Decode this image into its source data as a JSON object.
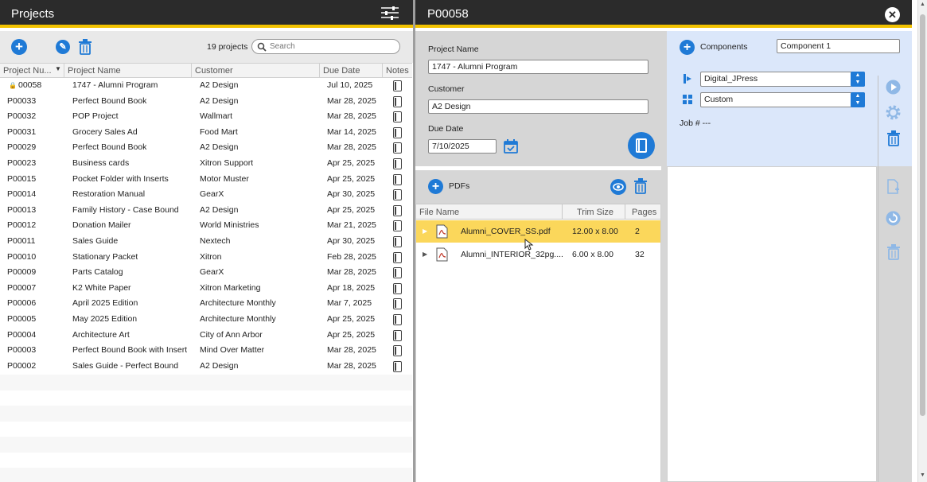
{
  "left_panel": {
    "title": "Projects",
    "project_count": "19 projects",
    "search_placeholder": "Search",
    "columns": [
      "Project Nu...",
      "Project Name",
      "Customer",
      "Due Date",
      "Notes"
    ],
    "rows": [
      [
        "00058",
        "1747 - Alumni Program",
        "A2 Design",
        "Jul 10, 2025"
      ],
      [
        "P00033",
        "Perfect Bound Book",
        "A2 Design",
        "Mar 28, 2025"
      ],
      [
        "P00032",
        "POP Project",
        "Wallmart",
        "Mar 28, 2025"
      ],
      [
        "P00031",
        "Grocery Sales Ad",
        "Food Mart",
        "Mar 14, 2025"
      ],
      [
        "P00029",
        "Perfect Bound Book",
        "A2 Design",
        "Mar 28, 2025"
      ],
      [
        "P00023",
        "Business cards",
        "Xitron Support",
        "Apr 25, 2025"
      ],
      [
        "P00015",
        "Pocket Folder with Inserts",
        "Motor Muster",
        "Apr 25, 2025"
      ],
      [
        "P00014",
        "Restoration Manual",
        "GearX",
        "Apr 30, 2025"
      ],
      [
        "P00013",
        "Family History - Case Bound",
        "A2 Design",
        "Apr 25, 2025"
      ],
      [
        "P00012",
        "Donation Mailer",
        "World Ministries",
        "Mar 21, 2025"
      ],
      [
        "P00011",
        "Sales Guide",
        "Nextech",
        "Apr 30, 2025"
      ],
      [
        "P00010",
        "Stationary Packet",
        "Xitron",
        "Feb 28, 2025"
      ],
      [
        "P00009",
        "Parts Catalog",
        "GearX",
        "Mar 28, 2025"
      ],
      [
        "P00007",
        "K2 White Paper",
        "Xitron Marketing",
        "Apr 18, 2025"
      ],
      [
        "P00006",
        "April 2025 Edition",
        "Architecture Monthly",
        "Mar 7, 2025"
      ],
      [
        "P00005",
        "May 2025 Edition",
        "Architecture Monthly",
        "Apr 25, 2025"
      ],
      [
        "P00004",
        "Architecture Art",
        "City of Ann Arbor",
        "Apr 25, 2025"
      ],
      [
        "P00003",
        "Perfect Bound Book with Insert",
        "Mind Over Matter",
        "Mar 28, 2025"
      ],
      [
        "P00002",
        "Sales Guide - Perfect Bound",
        "A2 Design",
        "Mar 28, 2025"
      ]
    ]
  },
  "detail": {
    "title": "P00058",
    "project_name_label": "Project Name",
    "project_name": "1747 - Alumni Program",
    "customer_label": "Customer",
    "customer": "A2 Design",
    "due_date_label": "Due Date",
    "due_date": "7/10/2025",
    "pdfs_label": "PDFs",
    "pdf_columns": [
      "File Name",
      "Trim Size",
      "Pages"
    ],
    "pdfs": [
      {
        "name": "Alumni_COVER_SS.pdf",
        "trim": "12.00 x 8.00",
        "pages": "2"
      },
      {
        "name": "Alumni_INTERIOR_32pg....",
        "trim": "6.00 x 8.00",
        "pages": "32"
      }
    ],
    "components_label": "Components",
    "component_name": "Component 1",
    "process": "Digital_JPress",
    "layout": "Custom",
    "job_label": "Job # ---"
  },
  "colors": {
    "accent": "#1f7ad6",
    "header": "#2b2b2b",
    "stripe": "#f2c200",
    "selected": "#fbd75b"
  }
}
